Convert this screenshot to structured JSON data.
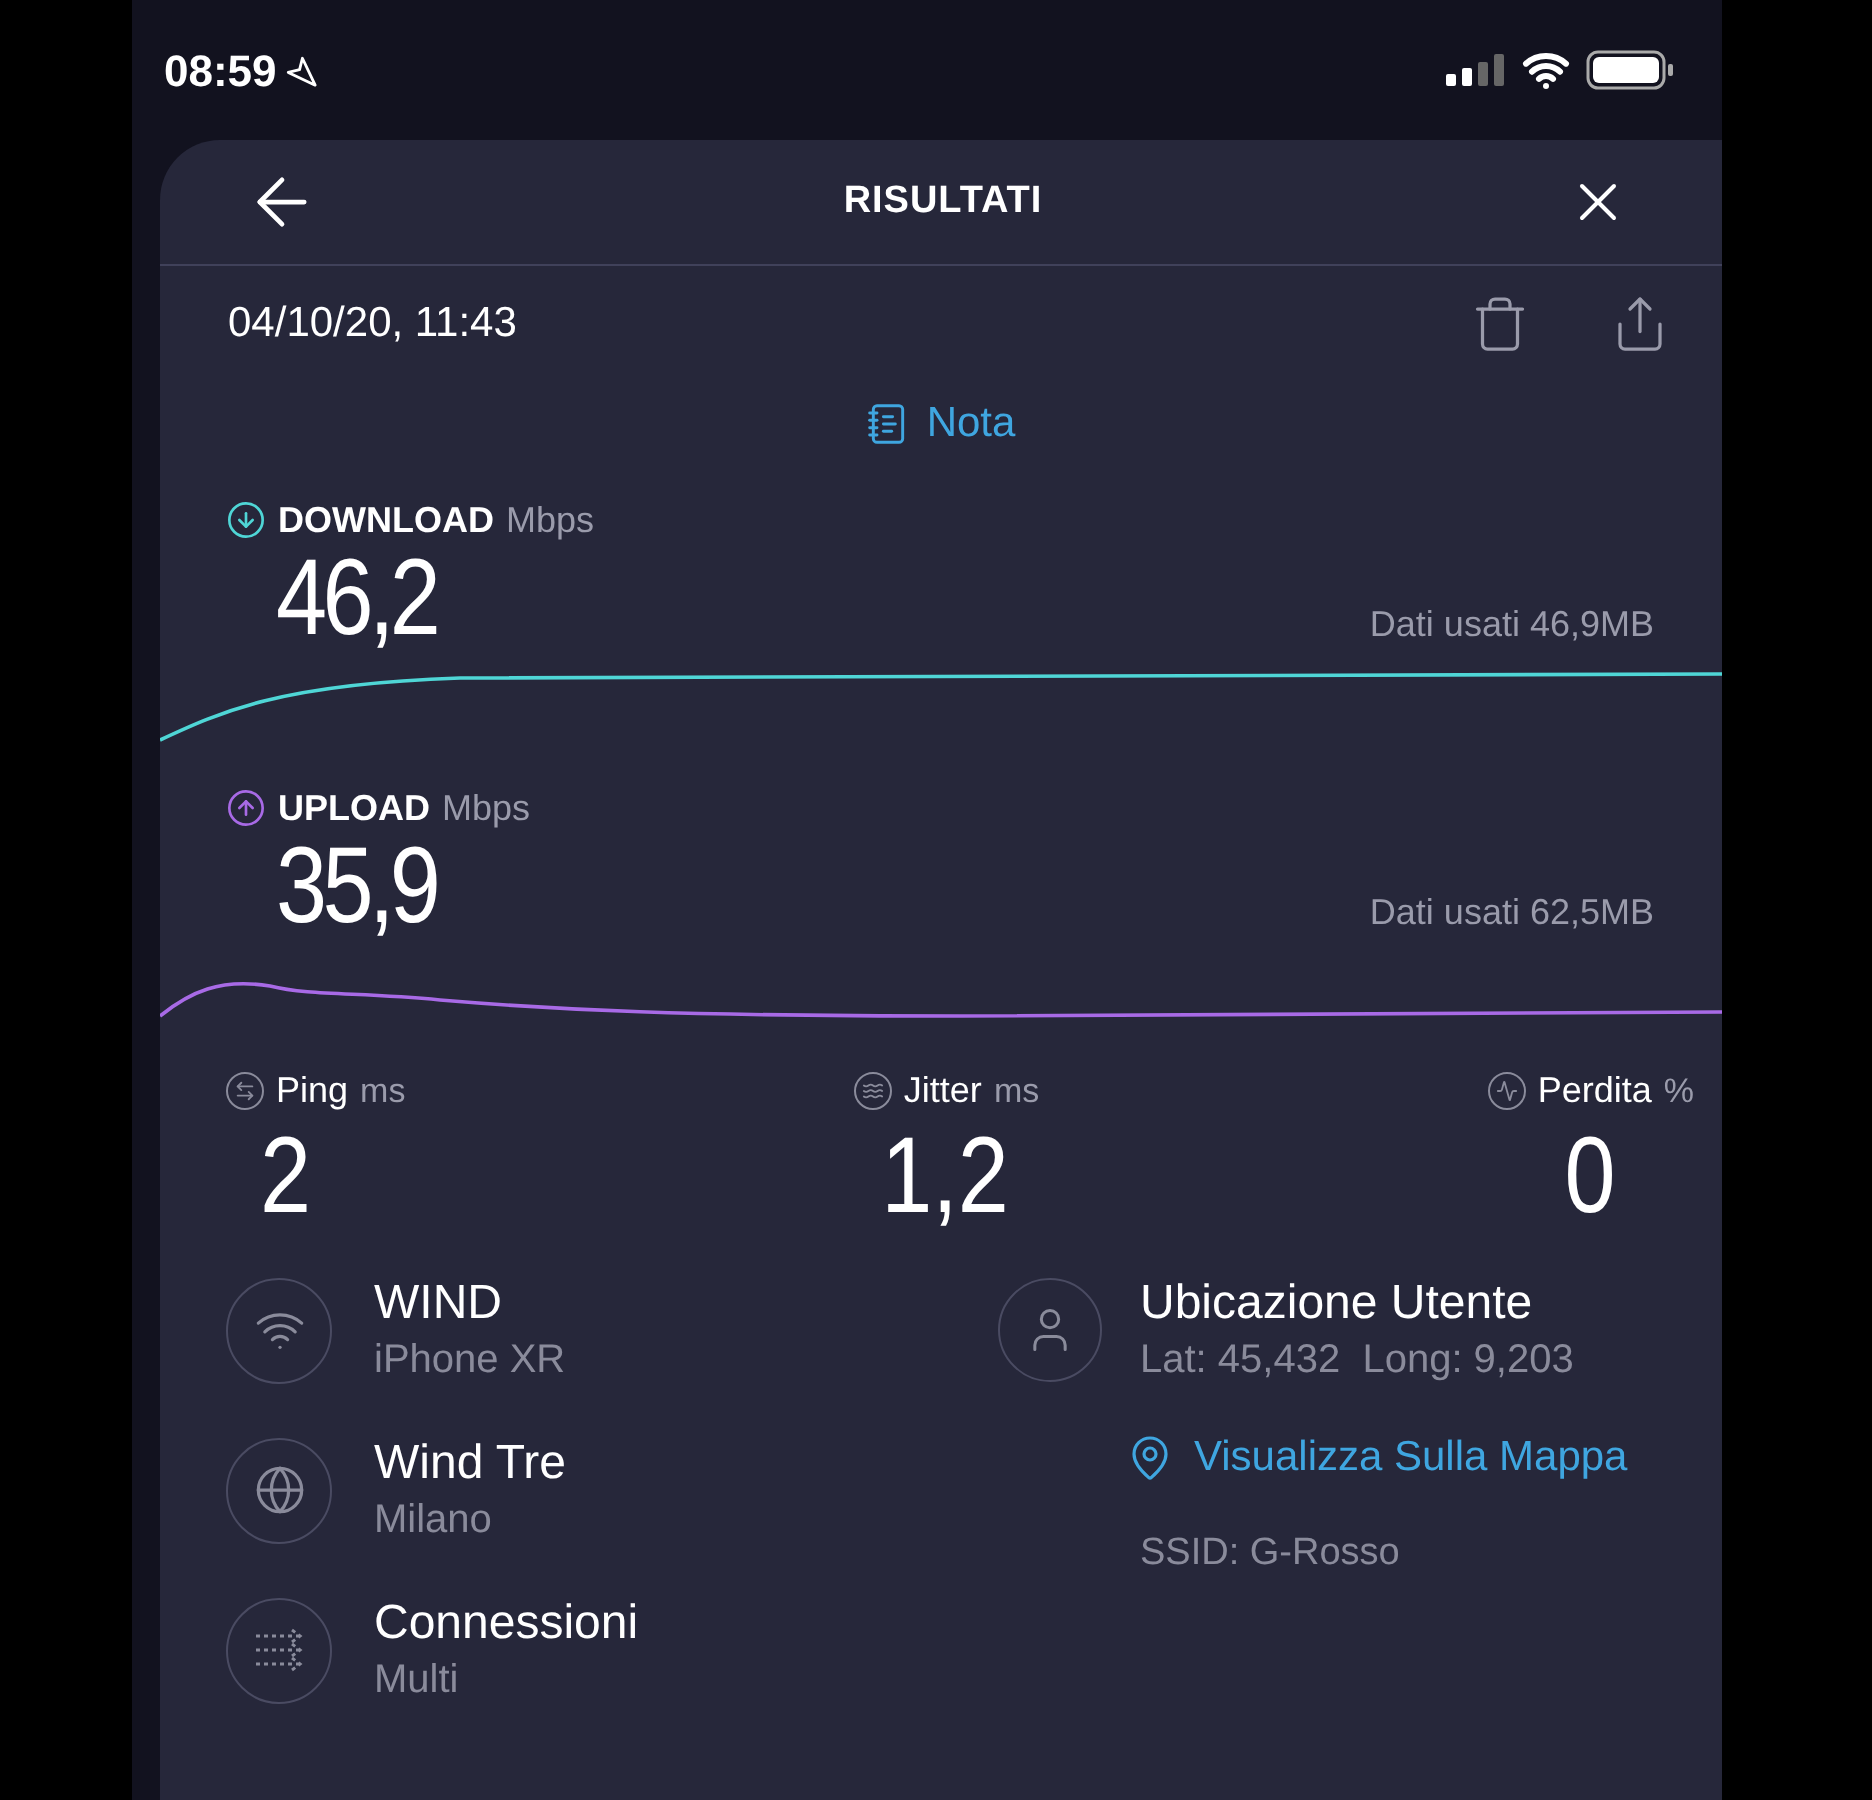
{
  "status_bar": {
    "time": "08:59"
  },
  "header": {
    "title": "RISULTATI"
  },
  "result": {
    "date": "04/10/20, 11:43",
    "note_link": "Nota"
  },
  "speeds": [
    {
      "kind": "download",
      "label": "DOWNLOAD",
      "unit": "Mbps",
      "value": "46,2",
      "data_used": "Dati usati 46,9MB",
      "color": "#4fd6d6"
    },
    {
      "kind": "upload",
      "label": "UPLOAD",
      "unit": "Mbps",
      "value": "35,9",
      "data_used": "Dati usati 62,5MB",
      "color": "#a86ae6"
    }
  ],
  "stats": [
    {
      "kind": "ping",
      "label": "Ping",
      "unit": "ms",
      "value": "2"
    },
    {
      "kind": "jitter",
      "label": "Jitter",
      "unit": "ms",
      "value": "1,2"
    },
    {
      "kind": "loss",
      "label": "Perdita",
      "unit": "%",
      "value": "0"
    }
  ],
  "connection": [
    {
      "kind": "wifi",
      "title": "WIND",
      "subtitle": "iPhone XR"
    },
    {
      "kind": "globe",
      "title": "Wind Tre",
      "subtitle": "Milano"
    },
    {
      "kind": "connections",
      "title": "Connessioni",
      "subtitle": "Multi"
    }
  ],
  "location": {
    "title": "Ubicazione Utente",
    "coordinates": "Lat: 45,432  Long: 9,203",
    "map_link": "Visualizza Sulla Mappa",
    "ssid": "SSID: G-Rosso"
  }
}
